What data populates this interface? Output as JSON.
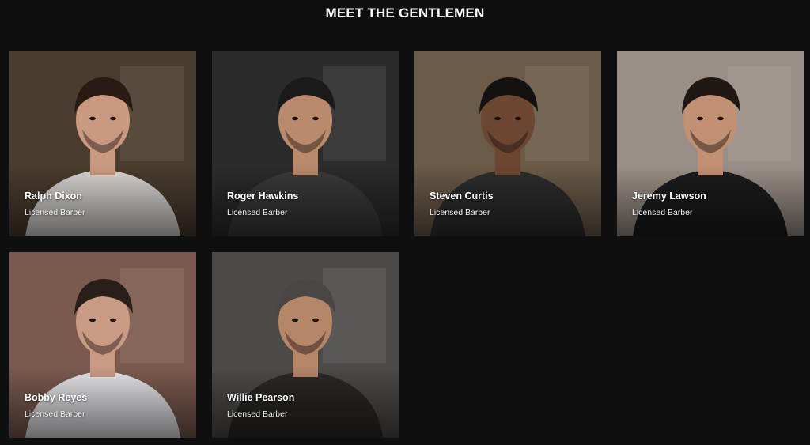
{
  "section": {
    "title": "MEET THE GENTLEMEN"
  },
  "barbers": [
    {
      "name": "Ralph Dixon",
      "role": "Licensed Barber",
      "bg": "#4a3c2e",
      "shirt": "#d9d6d4",
      "hair": "#2a1a14",
      "skin": "#c99a80"
    },
    {
      "name": "Roger Hawkins",
      "role": "Licensed Barber",
      "bg": "#2b2b2b",
      "shirt": "#3a3a3a",
      "hair": "#1a1a1a",
      "skin": "#b98a6c"
    },
    {
      "name": "Steven Curtis",
      "role": "Licensed Barber",
      "bg": "#6a5a48",
      "shirt": "#2d2d2d",
      "hair": "#141210",
      "skin": "#6b4630"
    },
    {
      "name": "Jeremy Lawson",
      "role": "Licensed Barber",
      "bg": "#9a8f86",
      "shirt": "#1c1c1e",
      "hair": "#1e1712",
      "skin": "#c29072"
    },
    {
      "name": "Bobby Reyes",
      "role": "Licensed Barber",
      "bg": "#7a5a4e",
      "shirt": "#e6e6ea",
      "hair": "#2a1f18",
      "skin": "#c99a84"
    },
    {
      "name": "Willie Pearson",
      "role": "Licensed Barber",
      "bg": "#4c4a48",
      "shirt": "#2a2826",
      "hair": "#4a4644",
      "skin": "#b58668"
    }
  ]
}
